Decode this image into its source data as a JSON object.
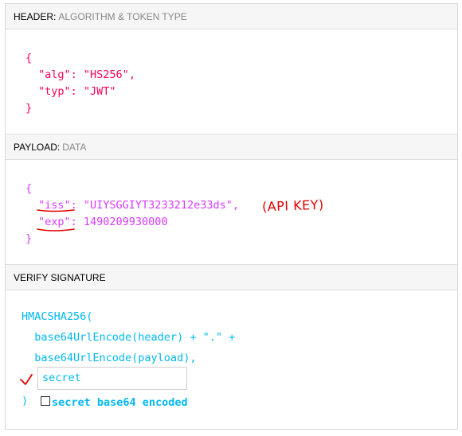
{
  "header_section": {
    "title": "HEADER:",
    "subtitle": "ALGORITHM & TOKEN TYPE",
    "open_brace": "{",
    "close_brace": "}",
    "fields": [
      {
        "key": "\"alg\"",
        "sep": ": ",
        "value": "\"HS256\"",
        "comma": ","
      },
      {
        "key": "\"typ\"",
        "sep": ": ",
        "value": "\"JWT\"",
        "comma": ""
      }
    ]
  },
  "payload_section": {
    "title": "PAYLOAD:",
    "subtitle": "DATA",
    "open_brace": "{",
    "close_brace": "}",
    "fields": [
      {
        "key": "\"iss\"",
        "sep": ": ",
        "value": "\"UIYSGGIYT3233212e33ds\"",
        "comma": ","
      },
      {
        "key": "\"exp\"",
        "sep": ": ",
        "value": "1490209930000",
        "comma": ""
      }
    ],
    "annotation": "(API KEY)"
  },
  "verify_section": {
    "title": "VERIFY SIGNATURE",
    "lines": [
      "HMACSHA256(",
      "  base64UrlEncode(header) + \".\" +",
      "  base64UrlEncode(payload),"
    ],
    "secret_value": "secret",
    "close_paren": ")",
    "checkbox_label": "secret base64 encoded",
    "checkbox_checked": false
  },
  "colors": {
    "header_json": "#fb015b",
    "payload_json": "#d63aff",
    "signature": "#00b9f1",
    "annotation": "#e00000"
  }
}
